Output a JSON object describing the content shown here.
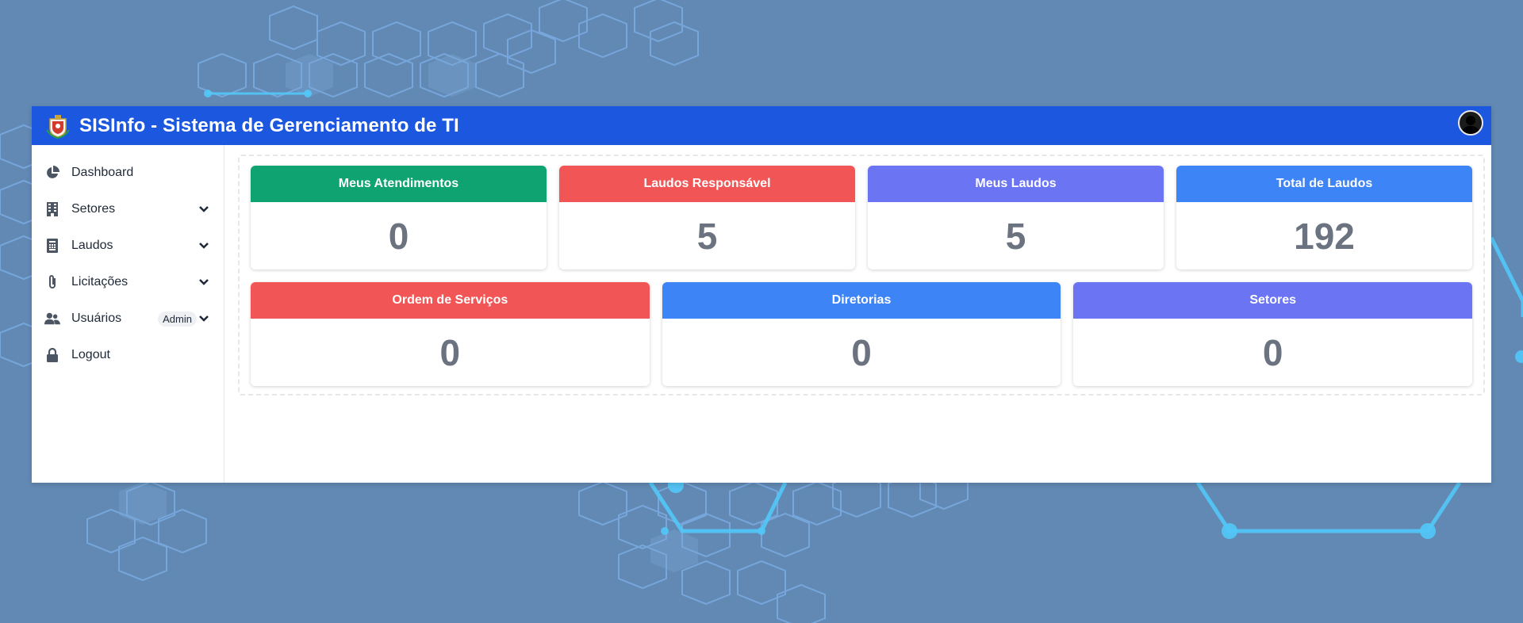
{
  "app": {
    "title": "SISInfo - Sistema de Gerenciamento de TI",
    "colors": {
      "topbar": "#1c57df",
      "background": "#6289b3",
      "green": "#0ea371",
      "red": "#f25555",
      "indigo": "#6b74f2",
      "blue": "#3d84f7"
    }
  },
  "sidebar": {
    "items": [
      {
        "label": "Dashboard",
        "icon": "pie-chart-icon"
      },
      {
        "label": "Setores",
        "icon": "building-icon",
        "has_dropdown": true
      },
      {
        "label": "Laudos",
        "icon": "document-icon",
        "has_dropdown": true
      },
      {
        "label": "Licitações",
        "icon": "paperclip-icon",
        "has_dropdown": true
      },
      {
        "label": "Usuários",
        "icon": "users-icon",
        "badge": "Admin",
        "has_dropdown": true
      },
      {
        "label": "Logout",
        "icon": "lock-icon"
      }
    ]
  },
  "cards": [
    {
      "title": "Meus Atendimentos",
      "value": "0",
      "color": "#0ea371"
    },
    {
      "title": "Laudos Responsável",
      "value": "5",
      "color": "#f25555"
    },
    {
      "title": "Meus Laudos",
      "value": "5",
      "color": "#6b74f2"
    },
    {
      "title": "Total de Laudos",
      "value": "192",
      "color": "#3d84f7"
    },
    {
      "title": "Ordem de Serviços",
      "value": "0",
      "color": "#f25555"
    },
    {
      "title": "Diretorias",
      "value": "0",
      "color": "#3d84f7"
    },
    {
      "title": "Setores",
      "value": "0",
      "color": "#6b74f2"
    }
  ]
}
